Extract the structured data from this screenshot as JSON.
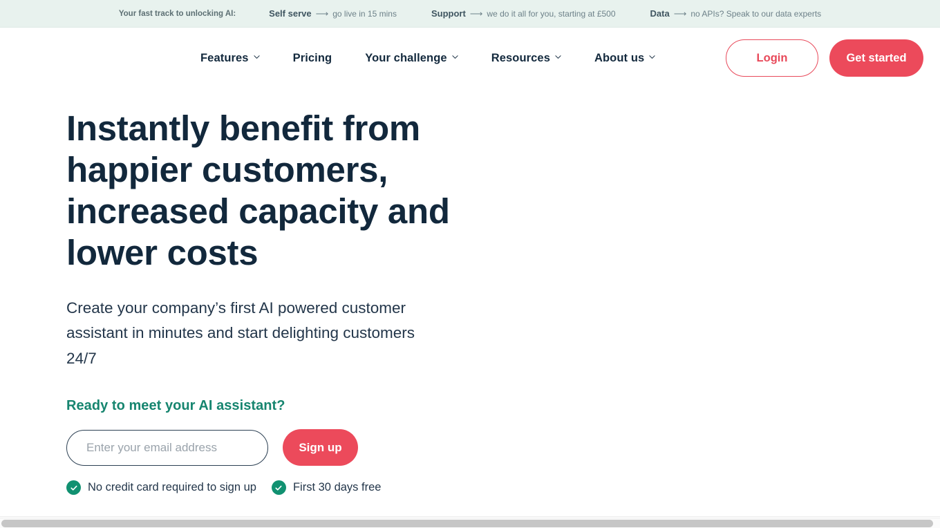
{
  "theme": {
    "accent_red": "#ec4a5b",
    "accent_green": "#16856f",
    "navy": "#12283c",
    "topbar_bg": "#e8f2ee",
    "tick_green": "#119171"
  },
  "topbar": {
    "intro": "Your fast track to unlocking AI:",
    "items": [
      {
        "label": "Self serve",
        "arrow": "⟶",
        "desc": "go live in 15 mins"
      },
      {
        "label": "Support",
        "arrow": "⟶",
        "desc": "we do it all for you, starting at £500"
      },
      {
        "label": "Data",
        "arrow": "⟶",
        "desc": "no APIs? Speak to our data experts"
      }
    ]
  },
  "nav": {
    "links": [
      {
        "label": "Features",
        "has_chevron": true
      },
      {
        "label": "Pricing",
        "has_chevron": false
      },
      {
        "label": "Your challenge",
        "has_chevron": true
      },
      {
        "label": "Resources",
        "has_chevron": true
      },
      {
        "label": "About us",
        "has_chevron": true
      }
    ],
    "login_label": "Login",
    "get_started_label": "Get started"
  },
  "hero": {
    "title": "Instantly benefit from happier customers, increased capacity and lower costs",
    "subtitle": "Create your company’s first AI powered customer assistant in minutes and start delighting customers 24/7",
    "cta_heading": "Ready to meet your AI assistant?"
  },
  "signup": {
    "email_placeholder": "Enter your email address",
    "email_value": "",
    "submit_label": "Sign up"
  },
  "ticks": [
    {
      "label": "No credit card required to sign up"
    },
    {
      "label": "First 30 days free"
    }
  ]
}
